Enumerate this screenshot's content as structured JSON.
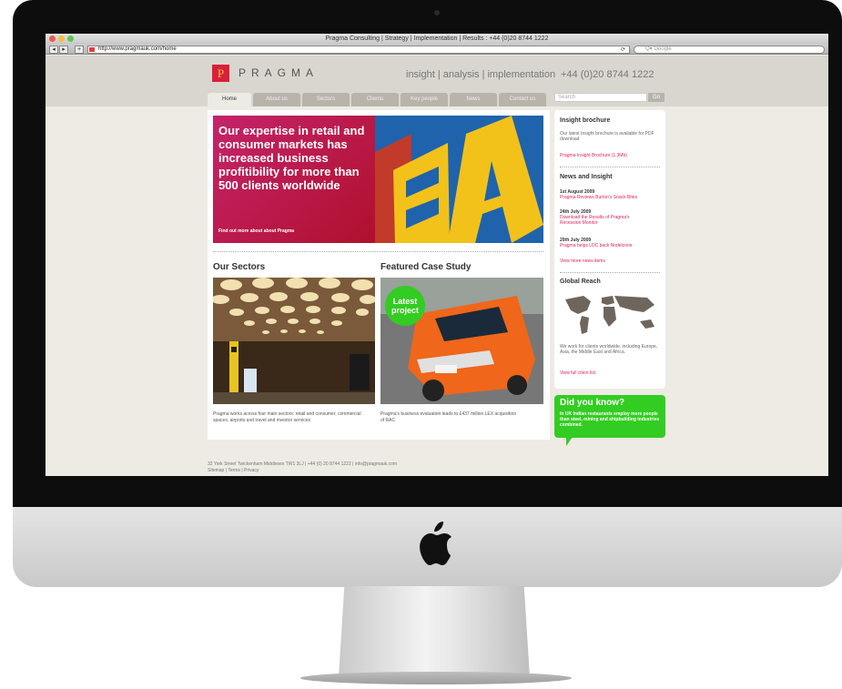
{
  "browser": {
    "title": "Pragma Consulting | Strategy | Implementation | Results : +44 (0)20 8744 1222",
    "url": "http://www.pragmauk.com/home",
    "search_placeholder": "Q▾ Google"
  },
  "site": {
    "logo_letter": "P",
    "brand": "PRAGMA",
    "tagline": "insight | analysis | implementation",
    "phone": "+44 (0)20 8744 1222",
    "nav": [
      "Home",
      "About us",
      "Sectors",
      "Clients",
      "Key people",
      "News",
      "Contact us"
    ],
    "search_placeholder": "Search",
    "go_label": "Go"
  },
  "hero": {
    "headline": "Our expertise in retail and consumer markets has increased business profitibility for more than 500 clients worldwide",
    "link": "Find out more about about Pragma"
  },
  "sectors": {
    "title": "Our Sectors",
    "caption": "Pragma works across four main sectors: retail and consumer, commercial spaces, airports and travel and investor services"
  },
  "case_study": {
    "title": "Featured Case Study",
    "badge": "Latest project",
    "caption": "Pragma's business evaluation leads to £437 million LEX acquisition of RAC"
  },
  "sidebar": {
    "brochure_title": "Insight brochure",
    "brochure_text": "Our latest Insight brochure is available for PDF download",
    "brochure_link": "Pragma Insight Brochure (1.3Mb)",
    "news_title": "News and Insight",
    "news": [
      {
        "date": "1st August 2009",
        "title": "Pragma Reviews Burton's Snack Bites"
      },
      {
        "date": "24th July 2009",
        "title": "Download the Results of Pragma's Recession Monitor"
      },
      {
        "date": "20th July 2009",
        "title": "Pragma helps LDC back Nodelzone"
      }
    ],
    "news_more": "View more news items",
    "reach_title": "Global Reach",
    "reach_text": "We work for clients worldwide, including Europe, Asia, the Middle East and Africa.",
    "reach_link": "View full client list",
    "dyk_title": "Did you know?",
    "dyk_text": "In UK Indian restaurants employ more people than steel, mining and shipbuilding industries combined."
  },
  "footer": {
    "address": "32 York Street Twickenham Middlesex TW1 3LJ | +44 (0) 20 8744 1222 | info@pragmauk.com",
    "links": "Sitemap | Terms | Privacy"
  },
  "colors": {
    "accent_pink": "#e0245e",
    "green": "#33cc22",
    "header_bg": "#d9d6cf",
    "logo_red": "#d8203a"
  }
}
